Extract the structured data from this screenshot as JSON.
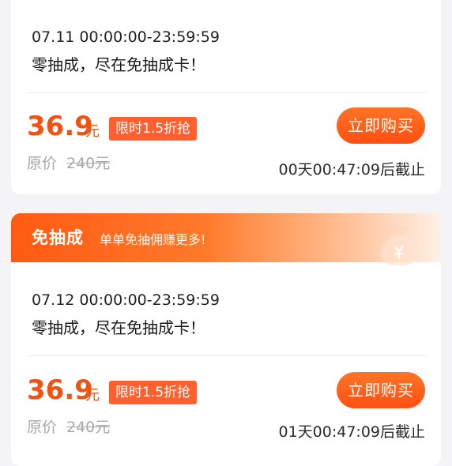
{
  "cards": [
    {
      "time_range": "07.11 00:00:00-23:59:59",
      "description": "零抽成，尽在免抽成卡！",
      "price": "36.9",
      "price_unit": "元",
      "discount_badge": "限时1.5折抢",
      "original_label": "原价",
      "original_price": "240元",
      "buy_label": "立即购买",
      "countdown": "00天00:47:09后截止"
    },
    {
      "header_title": "免抽成",
      "header_subtitle": "单单免抽佣赚更多!",
      "time_range": "07.12 00:00:00-23:59:59",
      "description": "零抽成，尽在免抽成卡！",
      "price": "36.9",
      "price_unit": "元",
      "discount_badge": "限时1.5折抢",
      "original_label": "原价",
      "original_price": "240元",
      "buy_label": "立即购买",
      "countdown": "01天00:47:09后截止"
    }
  ],
  "colors": {
    "accent": "#f2520f",
    "button": "#ff5a1a",
    "badge": "#ff6030",
    "background": "#f4f4f6"
  },
  "icons": {
    "header_decoration": "money-bag-icon"
  }
}
